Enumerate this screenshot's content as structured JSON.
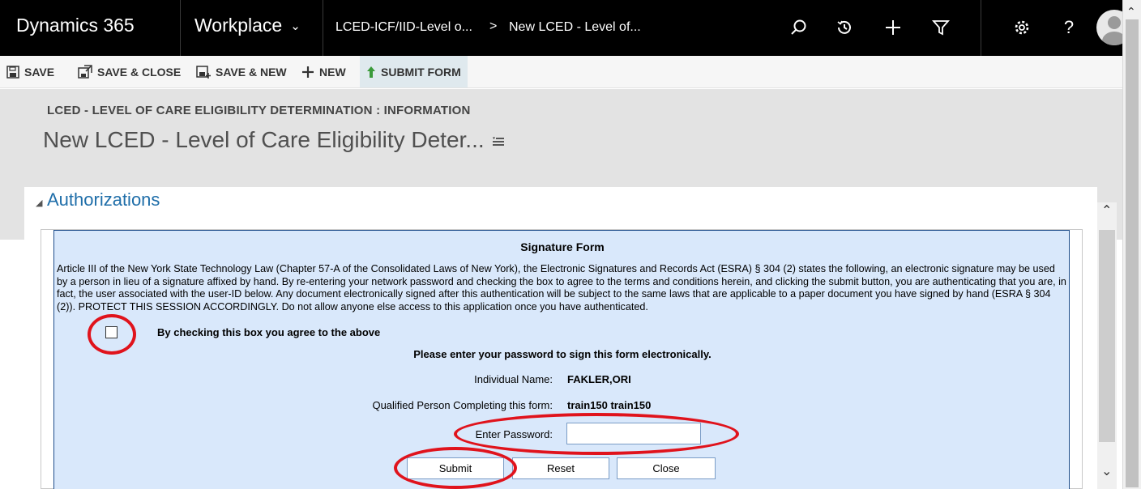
{
  "navbar": {
    "app_title": "Dynamics 365",
    "area": "Workplace",
    "breadcrumb_1": "LCED-ICF/IID-Level o...",
    "breadcrumb_sep": ">",
    "breadcrumb_2": "New LCED - Level of...",
    "icons": [
      "search-icon",
      "recent-icon",
      "add-icon",
      "filter-icon",
      "settings-icon",
      "help-icon",
      "avatar"
    ]
  },
  "commandbar": {
    "save": "SAVE",
    "save_close": "SAVE & CLOSE",
    "save_new": "SAVE & NEW",
    "new": "NEW",
    "submit_form": "SUBMIT FORM"
  },
  "header": {
    "entity_label": "LCED - LEVEL OF CARE ELIGIBILITY DETERMINATION : INFORMATION",
    "record_title": "New LCED - Level of Care Eligibility Deter..."
  },
  "section": {
    "title": "Authorizations"
  },
  "signature_form": {
    "title": "Signature Form",
    "legal_text": "Article III of the New York State Technology Law (Chapter 57-A of the Consolidated Laws of New York), the Electronic Signatures and Records Act (ESRA) § 304 (2) states the following, an electronic signature may be used by a person in lieu of a signature affixed by hand. By re-entering your network password and checking the box to agree to the terms and conditions herein, and clicking the submit button, you are authenticating that you are, in fact, the user associated with the user-ID below. Any document electronically signed after this authentication will be subject to the same laws that are applicable to a paper document you have signed by hand (ESRA § 304 (2)). PROTECT THIS SESSION ACCORDINGLY. Do not allow anyone else access to this application once you have authenticated.",
    "agree_label": "By checking this box you agree to the above",
    "agree_checked": false,
    "password_instruction": "Please enter your password to sign this form electronically.",
    "individual_label": "Individual Name:",
    "individual_value": "FAKLER,ORI",
    "qualified_label": "Qualified Person Completing this form:",
    "qualified_value": "train150 train150",
    "password_label": "Enter Password:",
    "password_value": "",
    "submit_label": "Submit",
    "reset_label": "Reset",
    "close_label": "Close"
  },
  "colors": {
    "navbar_bg": "#000000",
    "section_title": "#1f6ea9",
    "panel_bg": "#d9e8fb",
    "annotation": "#e0131c"
  }
}
